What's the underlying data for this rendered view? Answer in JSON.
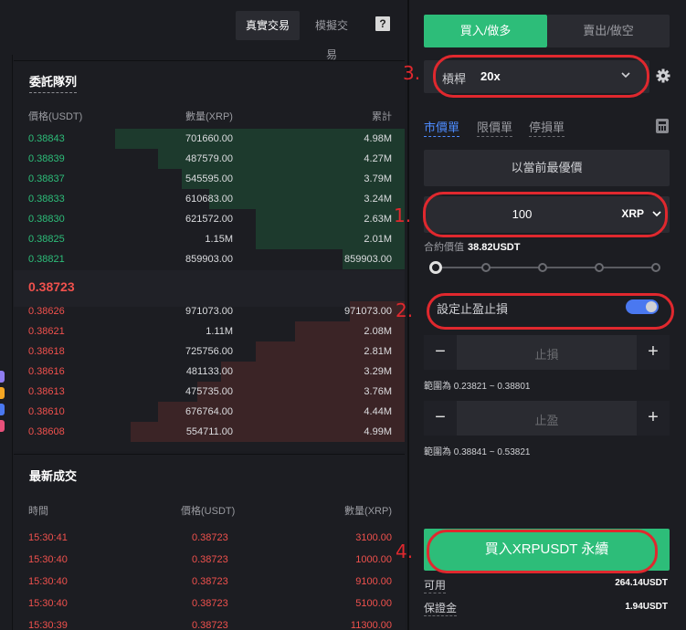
{
  "topbar": {
    "real_trade": "真實交易",
    "sim_trade": "模擬交易",
    "help_glyph": "?"
  },
  "orderbook": {
    "title": "委託隊列",
    "headers": {
      "price": "價格(USDT)",
      "qty": "數量(XRP)",
      "total": "累計"
    },
    "asks": [
      {
        "price": "0.38843",
        "qty": "701660.00",
        "total": "4.98M",
        "depth": 0.74
      },
      {
        "price": "0.38839",
        "qty": "487579.00",
        "total": "4.27M",
        "depth": 0.63
      },
      {
        "price": "0.38837",
        "qty": "545595.00",
        "total": "3.79M",
        "depth": 0.57
      },
      {
        "price": "0.38833",
        "qty": "610683.00",
        "total": "3.24M",
        "depth": 0.5
      },
      {
        "price": "0.38830",
        "qty": "621572.00",
        "total": "2.63M",
        "depth": 0.38
      },
      {
        "price": "0.38825",
        "qty": "1.15M",
        "total": "2.01M",
        "depth": 0.38
      },
      {
        "price": "0.38821",
        "qty": "859903.00",
        "total": "859903.00",
        "depth": 0.16
      }
    ],
    "mid_price": "0.38723",
    "bids": [
      {
        "price": "0.38626",
        "qty": "971073.00",
        "total": "971073.00",
        "depth": 0.14
      },
      {
        "price": "0.38621",
        "qty": "1.11M",
        "total": "2.08M",
        "depth": 0.28
      },
      {
        "price": "0.38618",
        "qty": "725756.00",
        "total": "2.81M",
        "depth": 0.38
      },
      {
        "price": "0.38616",
        "qty": "481133.00",
        "total": "3.29M",
        "depth": 0.47
      },
      {
        "price": "0.38613",
        "qty": "475735.00",
        "total": "3.76M",
        "depth": 0.53
      },
      {
        "price": "0.38610",
        "qty": "676764.00",
        "total": "4.44M",
        "depth": 0.63
      },
      {
        "price": "0.38608",
        "qty": "554711.00",
        "total": "4.99M",
        "depth": 0.7
      }
    ]
  },
  "trades": {
    "title": "最新成交",
    "headers": {
      "time": "時間",
      "price": "價格(USDT)",
      "qty": "數量(XRP)"
    },
    "rows": [
      {
        "time": "15:30:41",
        "price": "0.38723",
        "qty": "3100.00"
      },
      {
        "time": "15:30:40",
        "price": "0.38723",
        "qty": "1000.00"
      },
      {
        "time": "15:30:40",
        "price": "0.38723",
        "qty": "9100.00"
      },
      {
        "time": "15:30:40",
        "price": "0.38723",
        "qty": "5100.00"
      },
      {
        "time": "15:30:39",
        "price": "0.38723",
        "qty": "11300.00"
      }
    ]
  },
  "order_panel": {
    "tab_buy": "買入/做多",
    "tab_sell": "賣出/做空",
    "leverage_label": "槓桿",
    "leverage_value": "20x",
    "order_types": {
      "market": "市價單",
      "limit": "限價單",
      "stop": "停損單"
    },
    "best_price": "以當前最優價",
    "amount_value": "100",
    "amount_unit": "XRP",
    "contract_value_label": "合約價值",
    "contract_value": "38.82USDT",
    "leverage_slider_fraction": 0,
    "tpsl_label": "設定止盈止損",
    "tpsl_enabled": true,
    "stop_loss_placeholder": "止損",
    "stop_loss_range": "範圍為 0.23821 ~ 0.38801",
    "take_profit_placeholder": "止盈",
    "take_profit_range": "範圍為 0.38841 ~ 0.53821",
    "minus": "−",
    "plus": "+",
    "submit": "買入XRPUSDT 永續",
    "available_label": "可用",
    "available_value": "264.14USDT",
    "margin_label": "保證金",
    "margin_value": "1.94USDT"
  },
  "annotations": {
    "n1": "1.",
    "n2": "2.",
    "n3": "3.",
    "n4": "4."
  },
  "colors": {
    "buy_green": "#2dbd79",
    "sell_red": "#f0514d",
    "annotation_red": "#e0282e",
    "toggle_blue": "#4a78f0"
  }
}
